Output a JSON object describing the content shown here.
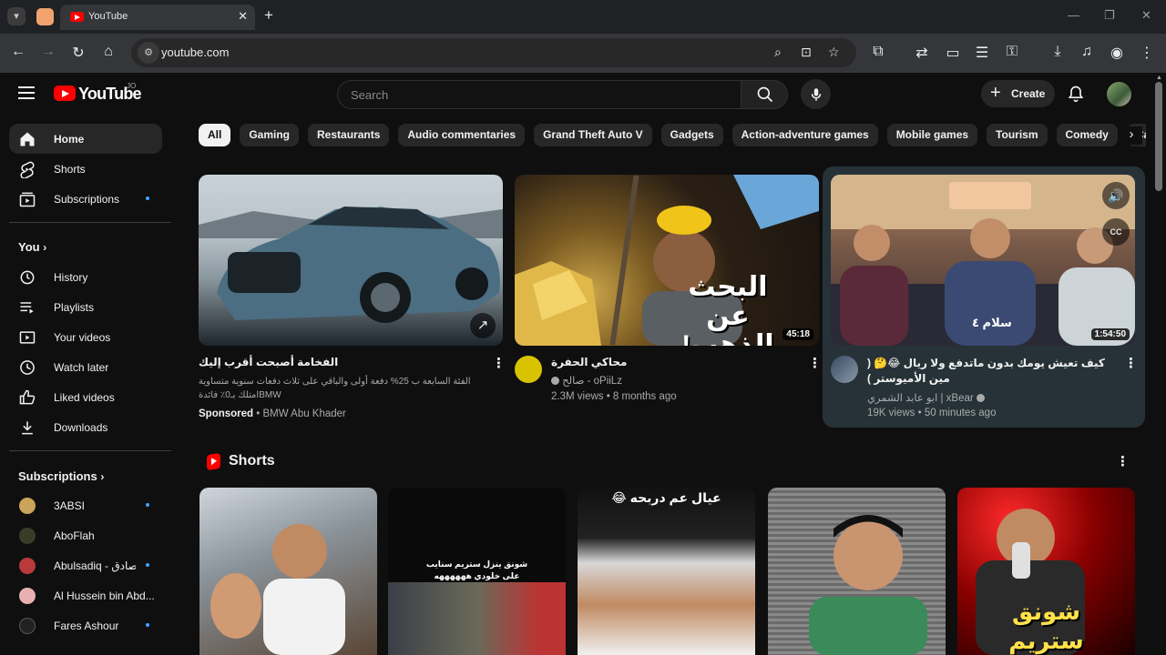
{
  "browser": {
    "tab_title": "YouTube",
    "url": "youtube.com"
  },
  "header": {
    "logo_text": "YouTube",
    "country_code": "JO",
    "search_placeholder": "Search",
    "create_label": "Create"
  },
  "sidebar": {
    "main": [
      {
        "label": "Home",
        "icon": "home-icon"
      },
      {
        "label": "Shorts",
        "icon": "shorts-icon"
      },
      {
        "label": "Subscriptions",
        "icon": "subscriptions-icon"
      }
    ],
    "you_heading": "You",
    "you_items": [
      {
        "label": "History",
        "icon": "history-icon"
      },
      {
        "label": "Playlists",
        "icon": "playlists-icon"
      },
      {
        "label": "Your videos",
        "icon": "your-videos-icon"
      },
      {
        "label": "Watch later",
        "icon": "watch-later-icon"
      },
      {
        "label": "Liked videos",
        "icon": "liked-videos-icon"
      },
      {
        "label": "Downloads",
        "icon": "downloads-icon"
      }
    ],
    "subs_heading": "Subscriptions",
    "subscriptions": [
      {
        "label": "3ABSI",
        "color": "#c9a45a"
      },
      {
        "label": "AboFlah",
        "color": "#3b3b2a"
      },
      {
        "label": "Abulsadiq - أبو الصادق",
        "color": "#b83a3a"
      },
      {
        "label": "Al Hussein bin Abd...",
        "color": "#e8b0b0"
      },
      {
        "label": "Fares Ashour",
        "color": "#222222"
      }
    ]
  },
  "chips": [
    "All",
    "Gaming",
    "Restaurants",
    "Audio commentaries",
    "Grand Theft Auto V",
    "Gadgets",
    "Action-adventure games",
    "Mobile games",
    "Tourism",
    "Comedy",
    "Cars"
  ],
  "videos": [
    {
      "title": "الفخامة أصبحت أقرب إليك",
      "description": "الفئة السابعة ب 25% دفعة أولى والباقي على ثلاث دفعات سنوية متساوية BMWامتلك بـ0٪ فائدة",
      "sponsored": "Sponsored",
      "advertiser": "• BMW Abu Khader"
    },
    {
      "title": "محاكي الحفرة",
      "channel": "صالح - oPiiLz",
      "views": "2.3M views • 8 months ago",
      "duration": "45:18",
      "overlay": "البحث عن الذهب!"
    },
    {
      "title": "كيف تعيش يومك بدون ماتدفع ولا ريال 😂🤔 ( مين الأميوستر )",
      "channel": "ابو عابد الشمري | xBear",
      "views": "19K views • 50 minutes ago",
      "duration": "1:54:50",
      "overlay": "سلام ٤"
    }
  ],
  "shorts": {
    "heading": "Shorts",
    "items": [
      {
        "overlay": ""
      },
      {
        "overlay": "شونق ينزل ستريم سنايب على خلودي ههههههه"
      },
      {
        "overlay": "عيال عم دربحه 😂"
      },
      {
        "overlay": ""
      },
      {
        "overlay": "شونق ستريم سنايب!!"
      }
    ]
  }
}
